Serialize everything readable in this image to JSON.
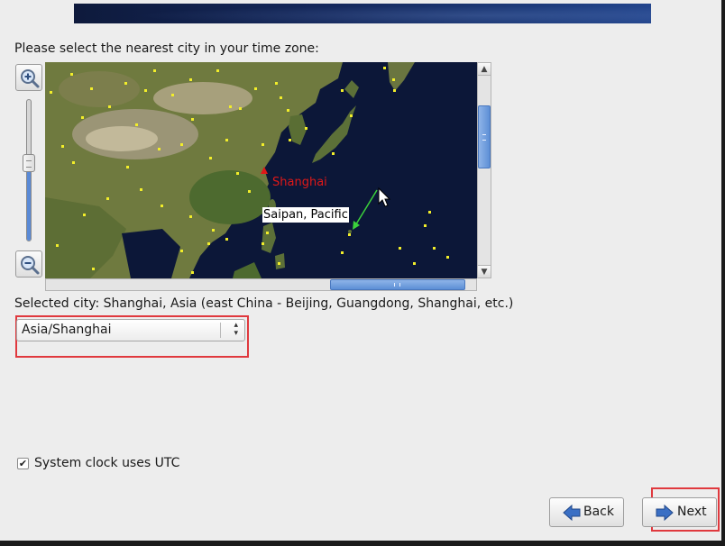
{
  "timezone": {
    "prompt": "Please select the nearest city in your time zone:",
    "selected_city_text": "Selected city: Shanghai, Asia (east China - Beijing, Guangdong, Shanghai, etc.)",
    "selected_timezone": "Asia/Shanghai",
    "map": {
      "selected_city_label": "Shanghai",
      "hover_city_label": "Saipan, Pacific",
      "zoom_level": 0.55
    }
  },
  "options": {
    "utc_label": "System clock uses UTC",
    "utc_checked": true,
    "utc_check_glyph": "✔"
  },
  "buttons": {
    "back_label": "Back",
    "next_label": "Next"
  },
  "icons": {
    "zoom_in": "zoom-in-icon",
    "zoom_out": "zoom-out-icon",
    "back": "back-arrow-icon",
    "next": "next-arrow-icon"
  },
  "colors": {
    "ocean": "#0c1738",
    "selected_city": "#e01818",
    "city_dot": "#f2ee2a",
    "highlight": "#e0393e",
    "accent": "#5d8fd6"
  }
}
